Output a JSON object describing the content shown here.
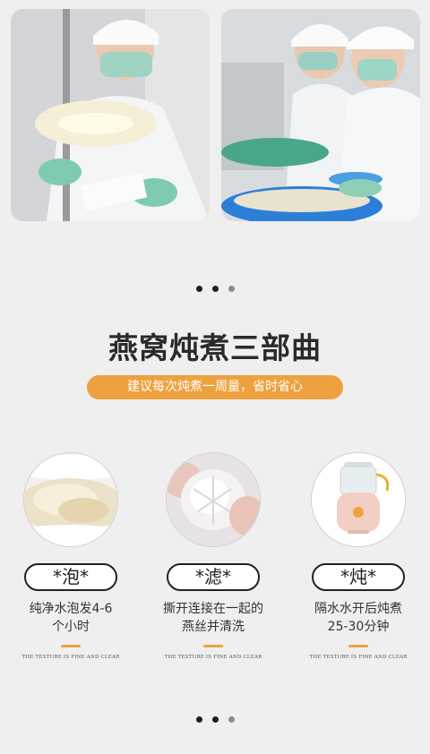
{
  "photos": [
    {
      "name": "lab-worker-inspecting-nest",
      "icon": "photo-lab-inspection"
    },
    {
      "name": "workers-cleaning-nests",
      "icon": "photo-cleaning-workers"
    }
  ],
  "pagination": {
    "count": 3,
    "active_index": 0
  },
  "section": {
    "title": "燕窝炖煮三部曲",
    "subtitle": "建议每次炖煮一周量，省时省心"
  },
  "steps": [
    {
      "label": "*泡*",
      "desc_line1": "纯净水泡发4-6",
      "desc_line2": "个小时",
      "caption": "THE TEXTURE IS FINE AND CLEAR"
    },
    {
      "label": "*滤*",
      "desc_line1": "撕开连接在一起的",
      "desc_line2": "燕丝并清洗",
      "caption": "THE TEXTURE IS FINE AND CLEAR"
    },
    {
      "label": "*炖*",
      "desc_line1": "隔水水开后炖煮",
      "desc_line2": "25-30分钟",
      "caption": "THE TEXTURE IS FINE AND CLEAR"
    }
  ],
  "colors": {
    "accent": "#eea13f",
    "background": "#efefef",
    "text": "#2a2a2a"
  }
}
